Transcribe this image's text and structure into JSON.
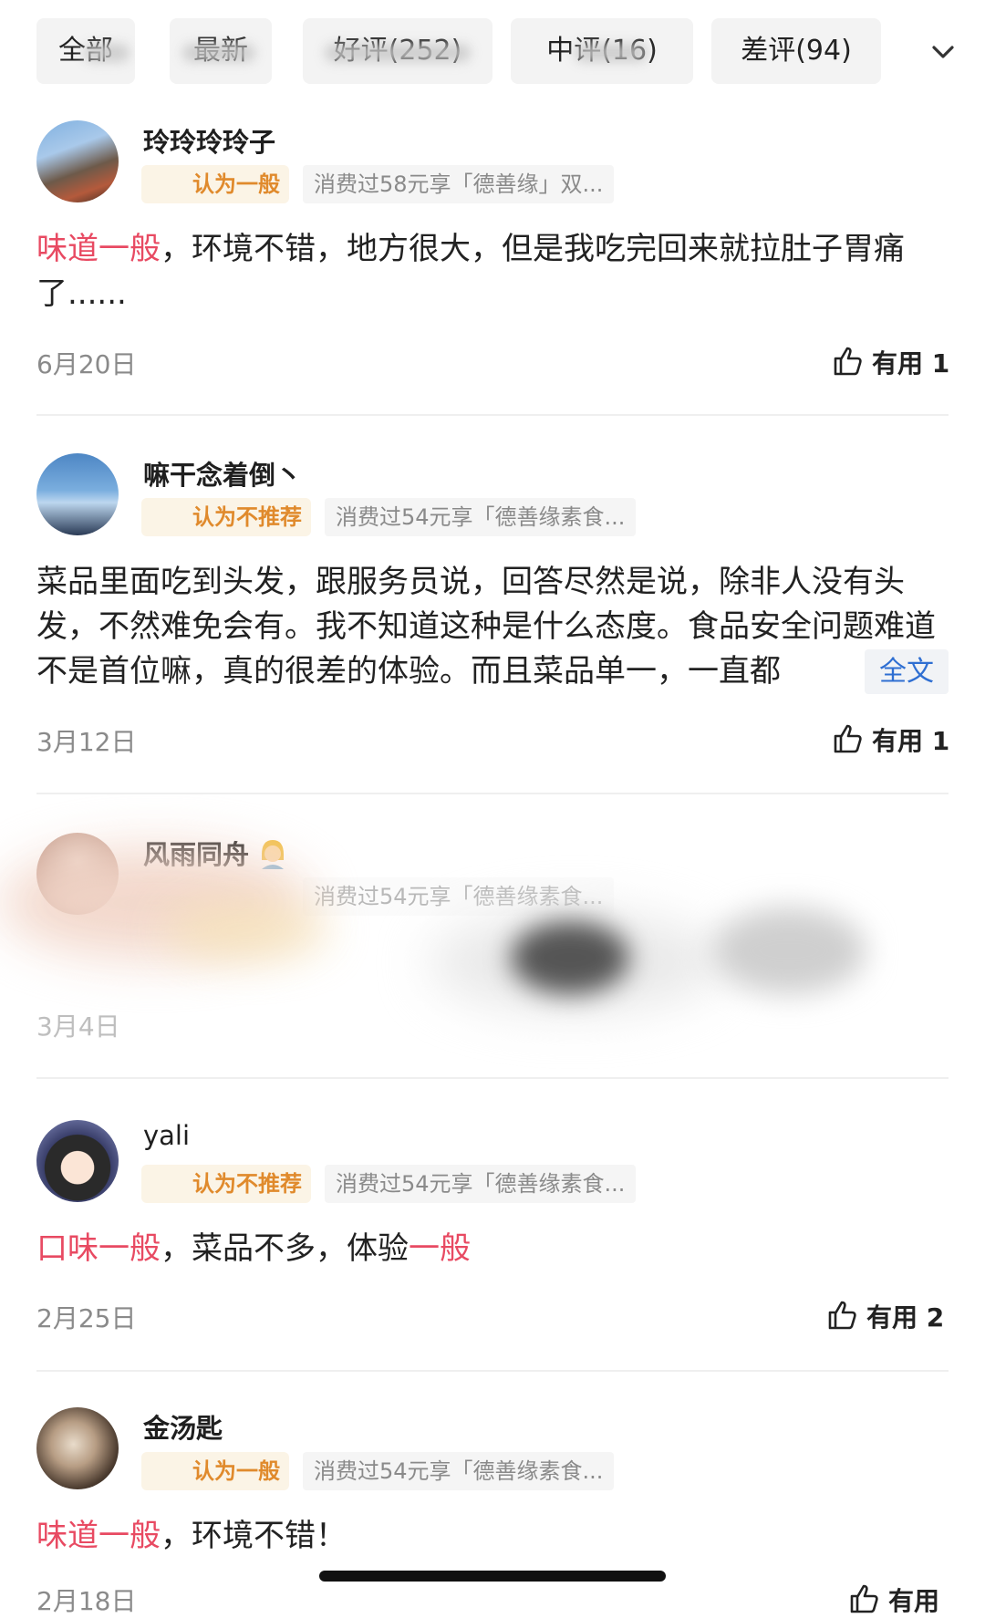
{
  "tabs": [
    {
      "label": "全部"
    },
    {
      "label": "最新"
    },
    {
      "label": "好评(252)"
    },
    {
      "label": "中评(16)"
    },
    {
      "label": "差评(94)"
    }
  ],
  "reviews": [
    {
      "username": "玲玲玲玲子",
      "rating_label": "认为一般",
      "spend_text": "消费过58元享「德善缘」双...",
      "body_hl1": "味道一般",
      "body_rest": "，环境不错，地方很大，但是我吃完回来就拉肚子胃痛了......",
      "date": "6月20日",
      "useful": "有用 1"
    },
    {
      "username": "嘛干念着倒丶",
      "rating_label": "认为不推荐",
      "spend_text": "消费过54元享「德善缘素食...",
      "body": "菜品里面吃到头发，跟服务员说，回答尽然是说，除非人没有头发，不然难免会有。我不知道这种是什么态度。食品安全问题难道不是首位嘛，真的很差的体验。而且菜品单一，一直都",
      "more_label": "全文",
      "date": "3月12日",
      "useful": "有用 1"
    },
    {
      "username": "风雨同舟",
      "spend_text": "消费过54元享「德善缘素食...",
      "date": "3月4日"
    },
    {
      "username": "yali",
      "rating_label": "认为不推荐",
      "spend_text": "消费过54元享「德善缘素食...",
      "body_hl1": "口味一般",
      "body_mid": "，菜品不多，体验",
      "body_hl2": "一般",
      "date": "2月25日",
      "useful": "有用 2"
    },
    {
      "username": "金汤匙",
      "rating_label": "认为一般",
      "spend_text": "消费过54元享「德善缘素食...",
      "body_hl1": "味道一般",
      "body_rest": "，环境不错！",
      "date": "2月18日",
      "useful": "有用"
    }
  ],
  "colors": {
    "highlight": "#e84a62",
    "rating_text": "#e08a2c",
    "link": "#2f6fd2"
  },
  "icons": [
    "chevron-down-icon",
    "thumbs-up-icon",
    "neutral-face-icon",
    "sad-face-icon",
    "smile-emoji-icon"
  ]
}
